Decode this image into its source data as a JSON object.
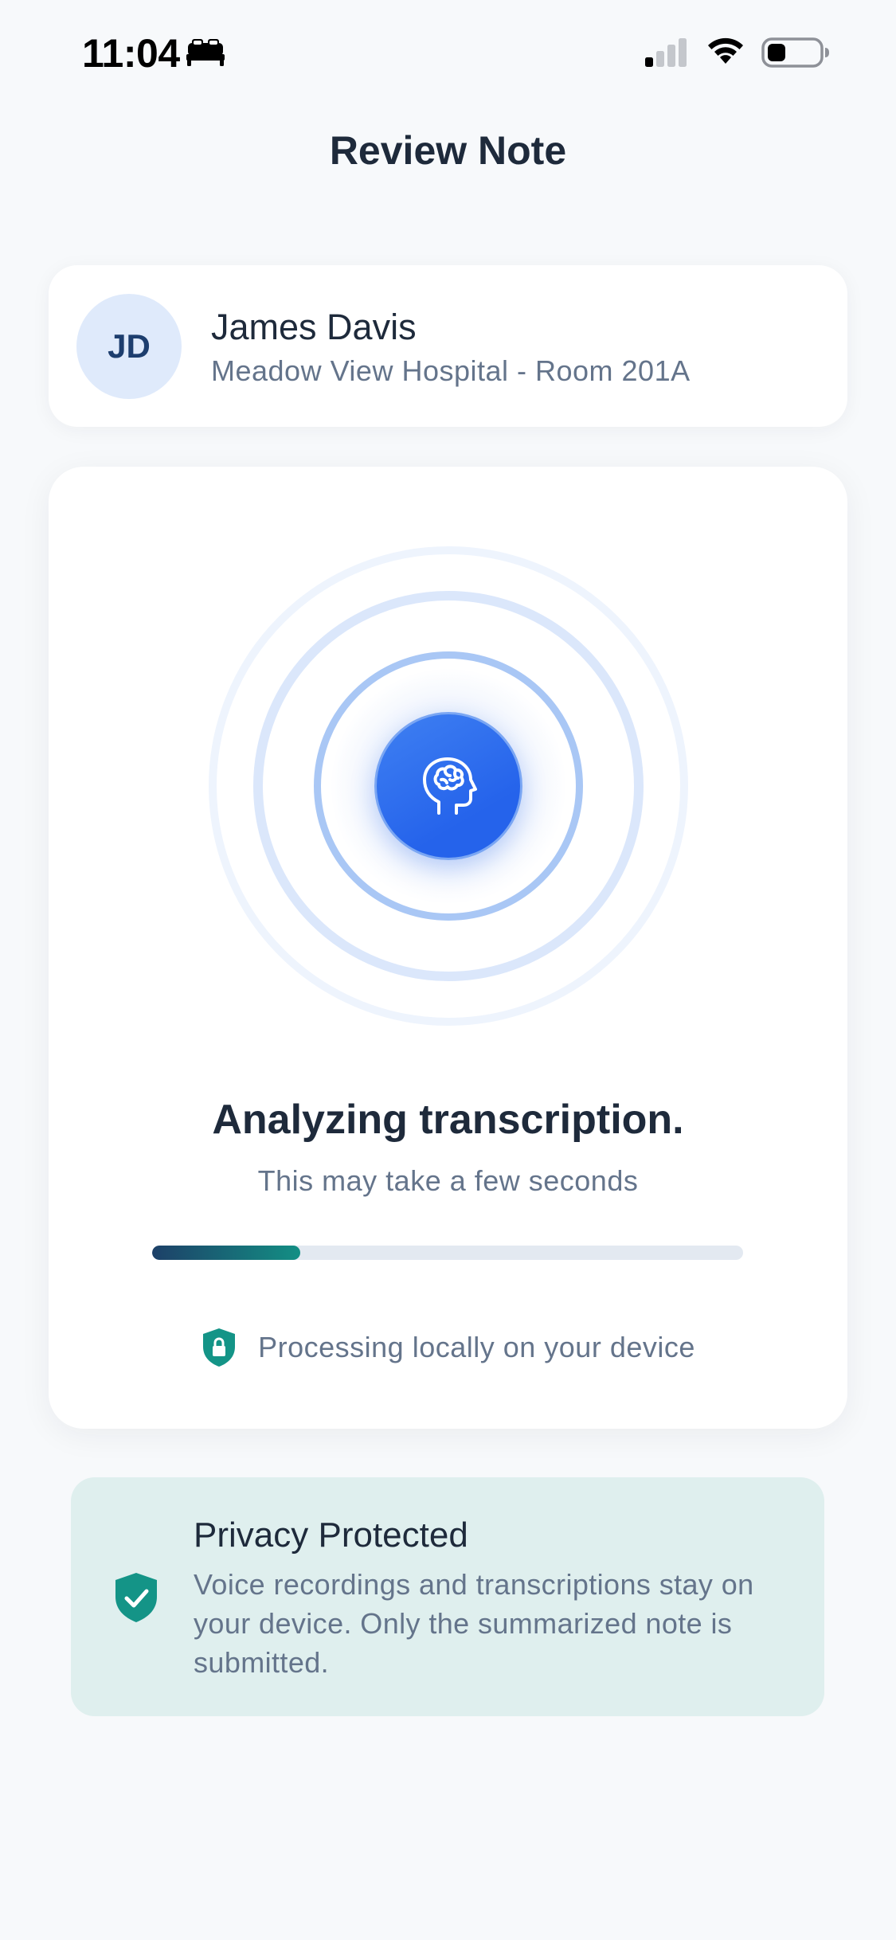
{
  "status_bar": {
    "time": "11:04",
    "icons": [
      "sleep-focus-icon",
      "cellular-signal-icon",
      "wifi-icon",
      "battery-icon"
    ]
  },
  "header": {
    "title": "Review Note"
  },
  "patient": {
    "initials": "JD",
    "name": "James Davis",
    "location": "Meadow View Hospital - Room 201A"
  },
  "analysis": {
    "icon": "brain-head-icon",
    "title": "Analyzing transcription.",
    "subtitle": "This may take a few seconds",
    "progress_percent": 25,
    "local_icon": "lock-shield-icon",
    "local_text": "Processing locally on your device"
  },
  "privacy": {
    "icon": "check-shield-icon",
    "title": "Privacy Protected",
    "body": "Voice recordings and transcriptions stay on your device. Only the summarized note is submitted."
  },
  "colors": {
    "accent_blue": "#2563eb",
    "teal": "#138f84",
    "navy": "#1d4068",
    "privacy_bg": "#dfefee",
    "page_bg": "#f7f9fb"
  }
}
